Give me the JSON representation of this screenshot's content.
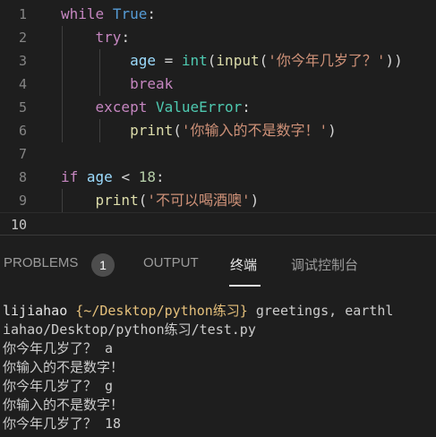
{
  "editor": {
    "lines": [
      {
        "number": "1",
        "tokens": [
          {
            "t": "while",
            "c": "kw-ctrl"
          },
          {
            "t": " ",
            "c": ""
          },
          {
            "t": "True",
            "c": "kw-blue"
          },
          {
            "t": ":",
            "c": ""
          }
        ]
      },
      {
        "number": "2",
        "tokens": [
          {
            "t": "    ",
            "c": ""
          },
          {
            "t": "try",
            "c": "kw-ctrl"
          },
          {
            "t": ":",
            "c": ""
          }
        ]
      },
      {
        "number": "3",
        "tokens": [
          {
            "t": "        ",
            "c": ""
          },
          {
            "t": "age",
            "c": "var"
          },
          {
            "t": " = ",
            "c": ""
          },
          {
            "t": "int",
            "c": "cls"
          },
          {
            "t": "(",
            "c": ""
          },
          {
            "t": "input",
            "c": "builtin"
          },
          {
            "t": "(",
            "c": ""
          },
          {
            "t": "'你今年几岁了？'",
            "c": "str"
          },
          {
            "t": "))",
            "c": ""
          }
        ]
      },
      {
        "number": "4",
        "tokens": [
          {
            "t": "        ",
            "c": ""
          },
          {
            "t": "break",
            "c": "kw-ctrl"
          }
        ]
      },
      {
        "number": "5",
        "tokens": [
          {
            "t": "    ",
            "c": ""
          },
          {
            "t": "except",
            "c": "kw-ctrl"
          },
          {
            "t": " ",
            "c": ""
          },
          {
            "t": "ValueError",
            "c": "cls"
          },
          {
            "t": ":",
            "c": ""
          }
        ]
      },
      {
        "number": "6",
        "tokens": [
          {
            "t": "        ",
            "c": ""
          },
          {
            "t": "print",
            "c": "builtin"
          },
          {
            "t": "(",
            "c": ""
          },
          {
            "t": "'你输入的不是数字！'",
            "c": "str"
          },
          {
            "t": ")",
            "c": ""
          }
        ]
      },
      {
        "number": "7",
        "tokens": []
      },
      {
        "number": "8",
        "tokens": [
          {
            "t": "if",
            "c": "kw-ctrl"
          },
          {
            "t": " ",
            "c": ""
          },
          {
            "t": "age",
            "c": "var"
          },
          {
            "t": " < ",
            "c": ""
          },
          {
            "t": "18",
            "c": "num"
          },
          {
            "t": ":",
            "c": ""
          }
        ]
      },
      {
        "number": "9",
        "tokens": [
          {
            "t": "    ",
            "c": ""
          },
          {
            "t": "print",
            "c": "builtin"
          },
          {
            "t": "(",
            "c": ""
          },
          {
            "t": "'不可以喝酒噢'",
            "c": "str"
          },
          {
            "t": ")",
            "c": ""
          }
        ]
      },
      {
        "number": "10",
        "tokens": [],
        "current": true
      }
    ]
  },
  "panel": {
    "tabs": [
      {
        "label": "PROBLEMS",
        "badge": "1"
      },
      {
        "label": "OUTPUT"
      },
      {
        "label": "终端",
        "active": true
      },
      {
        "label": "调试控制台"
      }
    ]
  },
  "terminal": {
    "prompt_user": "lijiahao",
    "prompt_path": "{~/Desktop/python练习}",
    "prompt_cmd": "greetings, earthl",
    "lines": [
      "iahao/Desktop/python练习/test.py",
      "你今年几岁了？ a",
      "你输入的不是数字！",
      "你今年几岁了？ g",
      "你输入的不是数字！",
      "你今年几岁了？ 18"
    ]
  },
  "colors": {
    "background": "#1e1e1e",
    "keyword_control": "#c586c0",
    "keyword_blue": "#569cd6",
    "function": "#dcdcaa",
    "variable": "#9cdcfe",
    "class": "#4ec9b0",
    "string": "#ce9178",
    "number": "#b5cea8"
  }
}
